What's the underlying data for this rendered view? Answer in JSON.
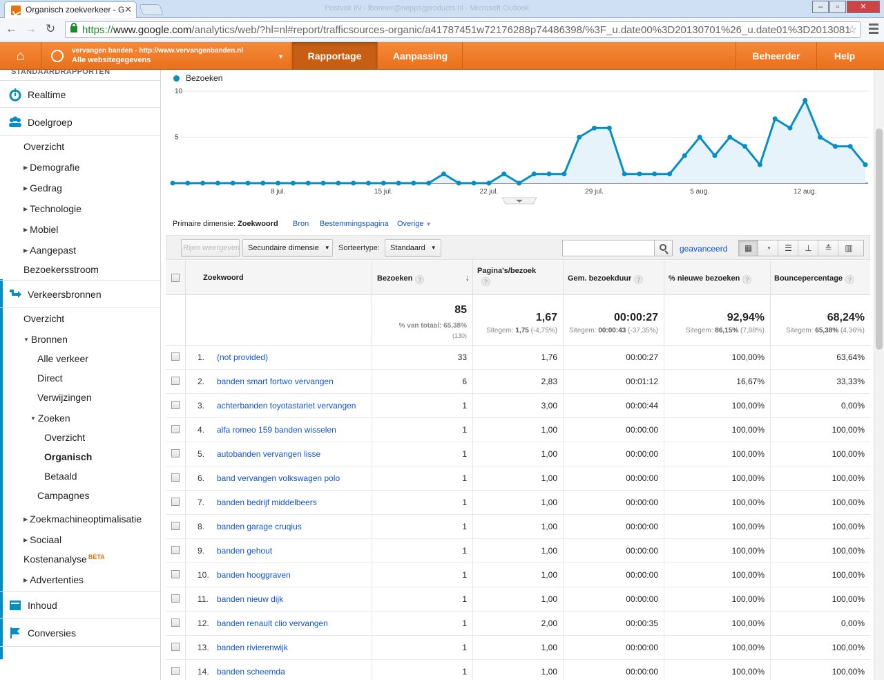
{
  "browser": {
    "tab_title": "Organisch zoekverkeer - G",
    "ghost_title": "Postvak IN - lbonner@neppsgproducts.nl - Microsoft Outlook",
    "url_scheme": "https://",
    "url_host": "www.google.com",
    "url_path": "/analytics/web/?hl=nl#report/trafficsources-organic/a41787451w72176288p74486398/%3F_u.date00%3D20130701%26_u.date01%3D2013081"
  },
  "header": {
    "account_site": "vervangen banden - http://www.vervangenbanden.nl",
    "account_view": "Alle websitegegevens",
    "nav": [
      "Rapportage",
      "Aanpassing"
    ],
    "right_nav": [
      "Beheerder",
      "Help"
    ]
  },
  "sidebar": {
    "section_head": "STANDAARDRAPPORTEN",
    "realtime": "Realtime",
    "doelgroep": "Doelgroep",
    "doelgroep_items": [
      "Overzicht",
      "Demografie",
      "Gedrag",
      "Technologie",
      "Mobiel",
      "Aangepast"
    ],
    "bezoekersstroom": "Bezoekersstroom",
    "verkeersbronnen": "Verkeersbronnen",
    "vb_overzicht": "Overzicht",
    "bronnen": "Bronnen",
    "bronnen_items": [
      "Alle verkeer",
      "Direct",
      "Verwijzingen"
    ],
    "zoeken": "Zoeken",
    "zoeken_items": [
      "Overzicht",
      "Organisch",
      "Betaald"
    ],
    "campagnes": "Campagnes",
    "seo": "Zoekmachineoptimalisatie",
    "sociaal": "Sociaal",
    "kostenanalyse": "Kostenanalyse",
    "beta": "BÈTA",
    "advertenties": "Advertenties",
    "inhoud": "Inhoud",
    "conversies": "Conversies"
  },
  "chart_data": {
    "type": "area",
    "series": [
      {
        "name": "Bezoeken",
        "color": "#058dc7",
        "values": [
          0,
          0,
          0,
          0,
          0,
          0,
          0,
          0,
          0,
          0,
          0,
          0,
          0,
          0,
          0,
          0,
          0,
          0,
          1,
          0,
          0,
          0,
          1,
          0,
          1,
          1,
          1,
          5,
          6,
          6,
          1,
          1,
          1,
          1,
          3,
          5,
          3,
          5,
          4,
          2,
          7,
          6,
          9,
          5,
          4,
          4,
          2
        ]
      }
    ],
    "x_start": "2013-07-01",
    "xtick_labels": [
      "8 jul.",
      "15 jul.",
      "22 jul.",
      "29 jul.",
      "5 aug.",
      "12 aug."
    ],
    "ytick_labels": [
      "10",
      "5"
    ],
    "ylim": [
      0,
      10
    ],
    "grid": true
  },
  "dimensions": {
    "label": "Primaire dimensie:",
    "selected": "Zoekwoord",
    "options": [
      "Bron",
      "Bestemmingspagina",
      "Overige"
    ]
  },
  "controls": {
    "rows_button": "Rijen weergeven",
    "secondary_dim": "Secundaire dimensie",
    "sort_label": "Sorteertype:",
    "sort_value": "Standaard",
    "search_placeholder": "",
    "advanced": "geavanceerd"
  },
  "table": {
    "headers": [
      "Zoekwoord",
      "Bezoeken",
      "Pagina's/bezoek",
      "Gem. bezoekduur",
      "% nieuwe bezoeken",
      "Bouncepercentage"
    ],
    "totals": {
      "bezoeken": "85",
      "bezoeken_sub1": "% van totaal: 65,38%",
      "bezoeken_sub2": "(130)",
      "pagina": "1,67",
      "pagina_sub_lbl": "Sitegem: ",
      "pagina_sub_val": "1,75",
      "pagina_sub_pct": "(-4,75%)",
      "duur": "00:00:27",
      "duur_sub_lbl": "Sitegem: ",
      "duur_sub_val": "00:00:43",
      "duur_sub_pct": "(-37,35%)",
      "nieuw": "92,94%",
      "nieuw_sub_lbl": "Sitegem: ",
      "nieuw_sub_val": "86,15%",
      "nieuw_sub_pct": "(7,88%)",
      "bounce": "68,24%",
      "bounce_sub_lbl": "Sitegem: ",
      "bounce_sub_val": "65,38%",
      "bounce_sub_pct": "(4,36%)"
    },
    "rows": [
      {
        "n": "1.",
        "kw": "(not provided)",
        "v": "33",
        "p": "1,76",
        "d": "00:00:27",
        "nw": "100,00%",
        "b": "63,64%"
      },
      {
        "n": "2.",
        "kw": "banden smart fortwo vervangen",
        "v": "6",
        "p": "2,83",
        "d": "00:01:12",
        "nw": "16,67%",
        "b": "33,33%"
      },
      {
        "n": "3.",
        "kw": "achterbanden toyotastarlet vervangen",
        "v": "1",
        "p": "3,00",
        "d": "00:00:44",
        "nw": "100,00%",
        "b": "0,00%"
      },
      {
        "n": "4.",
        "kw": "alfa romeo 159 banden wisselen",
        "v": "1",
        "p": "1,00",
        "d": "00:00:00",
        "nw": "100,00%",
        "b": "100,00%"
      },
      {
        "n": "5.",
        "kw": "autobanden vervangen lisse",
        "v": "1",
        "p": "1,00",
        "d": "00:00:00",
        "nw": "100,00%",
        "b": "100,00%"
      },
      {
        "n": "6.",
        "kw": "band vervangen volkswagen polo",
        "v": "1",
        "p": "1,00",
        "d": "00:00:00",
        "nw": "100,00%",
        "b": "100,00%"
      },
      {
        "n": "7.",
        "kw": "banden bedrijf middelbeers",
        "v": "1",
        "p": "1,00",
        "d": "00:00:00",
        "nw": "100,00%",
        "b": "100,00%"
      },
      {
        "n": "8.",
        "kw": "banden garage cruqius",
        "v": "1",
        "p": "1,00",
        "d": "00:00:00",
        "nw": "100,00%",
        "b": "100,00%"
      },
      {
        "n": "9.",
        "kw": "banden gehout",
        "v": "1",
        "p": "1,00",
        "d": "00:00:00",
        "nw": "100,00%",
        "b": "100,00%"
      },
      {
        "n": "10.",
        "kw": "banden hooggraven",
        "v": "1",
        "p": "1,00",
        "d": "00:00:00",
        "nw": "100,00%",
        "b": "100,00%"
      },
      {
        "n": "11.",
        "kw": "banden nieuw dijk",
        "v": "1",
        "p": "1,00",
        "d": "00:00:00",
        "nw": "100,00%",
        "b": "100,00%"
      },
      {
        "n": "12.",
        "kw": "banden renault clio vervangen",
        "v": "1",
        "p": "2,00",
        "d": "00:00:35",
        "nw": "100,00%",
        "b": "0,00%"
      },
      {
        "n": "13.",
        "kw": "banden rivierenwijk",
        "v": "1",
        "p": "1,00",
        "d": "00:00:00",
        "nw": "100,00%",
        "b": "100,00%"
      },
      {
        "n": "14.",
        "kw": "banden scheemda",
        "v": "1",
        "p": "1,00",
        "d": "00:00:00",
        "nw": "100,00%",
        "b": "100,00%"
      }
    ]
  }
}
